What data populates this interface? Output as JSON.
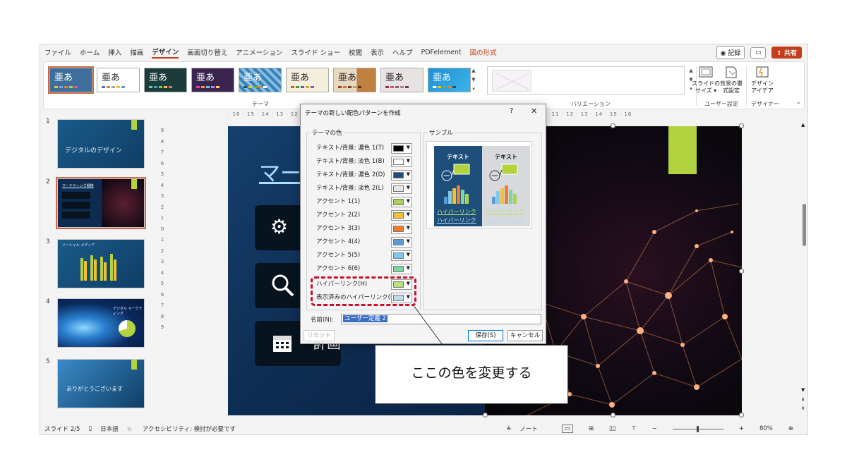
{
  "menubar": {
    "tabs": [
      "ファイル",
      "ホーム",
      "挿入",
      "描画",
      "デザイン",
      "画面切り替え",
      "アニメーション",
      "スライド ショー",
      "校閲",
      "表示",
      "ヘルプ",
      "PDFelement",
      "図の形式"
    ],
    "active_index": 4,
    "record_label": "◉ 記録",
    "share_label": "共有"
  },
  "ribbon": {
    "theme_glyph": "亜あ",
    "theme_group_label": "テーマ",
    "variations_group_label": "バリエーション",
    "user_group_label": "ユーザー設定",
    "designer_group_label": "デザイナー",
    "slide_size_label": "スライドの サイズ ▾",
    "bg_format_label": "背景の書 式設定",
    "design_ideas_label": "デザイン アイデア"
  },
  "thumbnails": [
    {
      "num": "1",
      "text": "デジタルのデザイン"
    },
    {
      "num": "2",
      "text": "マーケティング戦略"
    },
    {
      "num": "3",
      "text": "ソーシャル メディア"
    },
    {
      "num": "4",
      "text": "デジタル マーケティング"
    },
    {
      "num": "5",
      "text": "ありがとうございます"
    }
  ],
  "ruler": {
    "horizontal": "· 16 · 15 · 14 · 13 · 12 · 11 · 10 · 9 · 8 · 7 · 6 · 5 · 4 · 3 · 2 · 1 · 0 · 1 · 2 · 3 · 4 · 5 · 6 · 7 · 8 · 9 · 10 · 11 · 12 · 13 · 14 · 15 · 16 ·",
    "vertical": [
      "9",
      "8",
      "7",
      "6",
      "5",
      "4",
      "3",
      "2",
      "1",
      "0",
      "1",
      "2",
      "3",
      "4",
      "5",
      "6",
      "7",
      "8",
      "9"
    ]
  },
  "slide": {
    "title": "マーケ",
    "card3_text": "計画"
  },
  "dialog": {
    "title": "テーマの新しい配色パターンを作成",
    "help": "?",
    "close": "✕",
    "theme_colors_label": "テーマの色",
    "sample_label": "サンプル",
    "rows": [
      {
        "label": "テキスト/背景: 濃色 1(T)",
        "color": "#000000"
      },
      {
        "label": "テキスト/背景: 淡色 1(B)",
        "color": "#ffffff"
      },
      {
        "label": "テキスト/背景: 濃色 2(D)",
        "color": "#1f4e79"
      },
      {
        "label": "テキスト/背景: 淡色 2(L)",
        "color": "#e7e6e6"
      },
      {
        "label": "アクセント 1(1)",
        "color": "#a9d25c"
      },
      {
        "label": "アクセント 2(2)",
        "color": "#f2c037"
      },
      {
        "label": "アクセント 3(3)",
        "color": "#ed7d31"
      },
      {
        "label": "アクセント 4(4)",
        "color": "#5b9bd5"
      },
      {
        "label": "アクセント 5(5)",
        "color": "#7fc8f0"
      },
      {
        "label": "アクセント 6(6)",
        "color": "#7ed6a0"
      },
      {
        "label": "ハイパーリンク(H)",
        "color": "#b9e27a"
      },
      {
        "label": "表示済みのハイパーリンク(F)",
        "color": "#bcd9f2"
      }
    ],
    "sample_text": "テキスト",
    "sample_link": "ハイパーリンク",
    "name_label": "名前(N):",
    "name_value": "ユーザー定義 2",
    "reset_label": "リセット(R)",
    "save_label": "保存(S)",
    "cancel_label": "キャンセル"
  },
  "callout": {
    "text": "ここの色を変更する"
  },
  "status": {
    "slide": "スライド 2/5",
    "lang": "日本語",
    "access": "アクセシビリティ: 検討が必要です",
    "notes": "ノート",
    "zoom": "80%"
  },
  "colors": {
    "accent": "#c43e1c",
    "highlight": "#c8102e",
    "slide_accent": "#b2d23e"
  }
}
